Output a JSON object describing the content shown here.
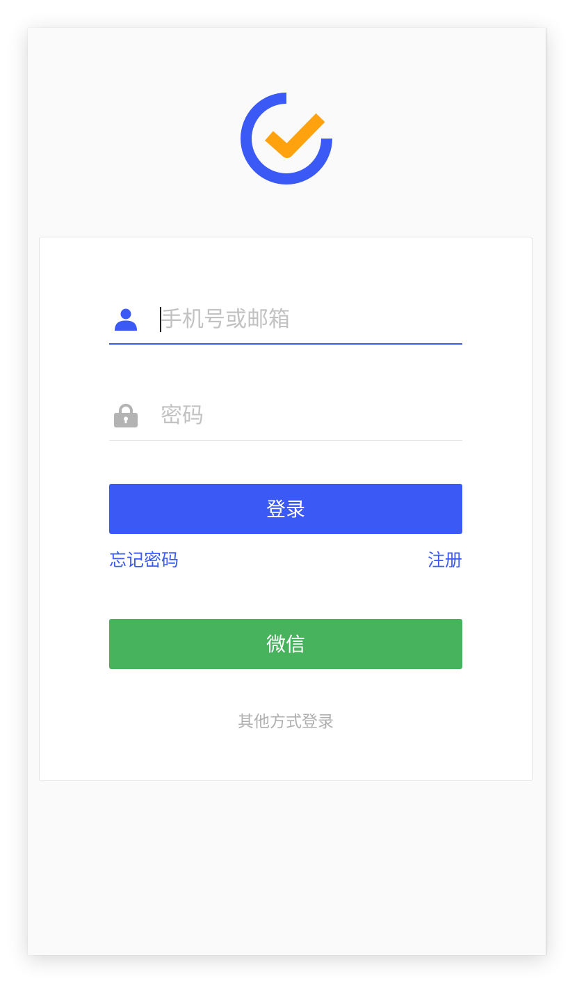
{
  "app": {
    "logo_icon": "tick-check-logo-icon",
    "colors": {
      "brand_blue": "#3a59f5",
      "check_orange": "#ffa20d",
      "wechat_green": "#47b35d"
    }
  },
  "form": {
    "username": {
      "icon": "user-icon",
      "placeholder": "手机号或邮箱",
      "value": ""
    },
    "password": {
      "icon": "lock-icon",
      "placeholder": "密码",
      "value": ""
    },
    "login_label": "登录",
    "forgot_label": "忘记密码",
    "register_label": "注册",
    "wechat_label": "微信",
    "other_login_label": "其他方式登录"
  }
}
